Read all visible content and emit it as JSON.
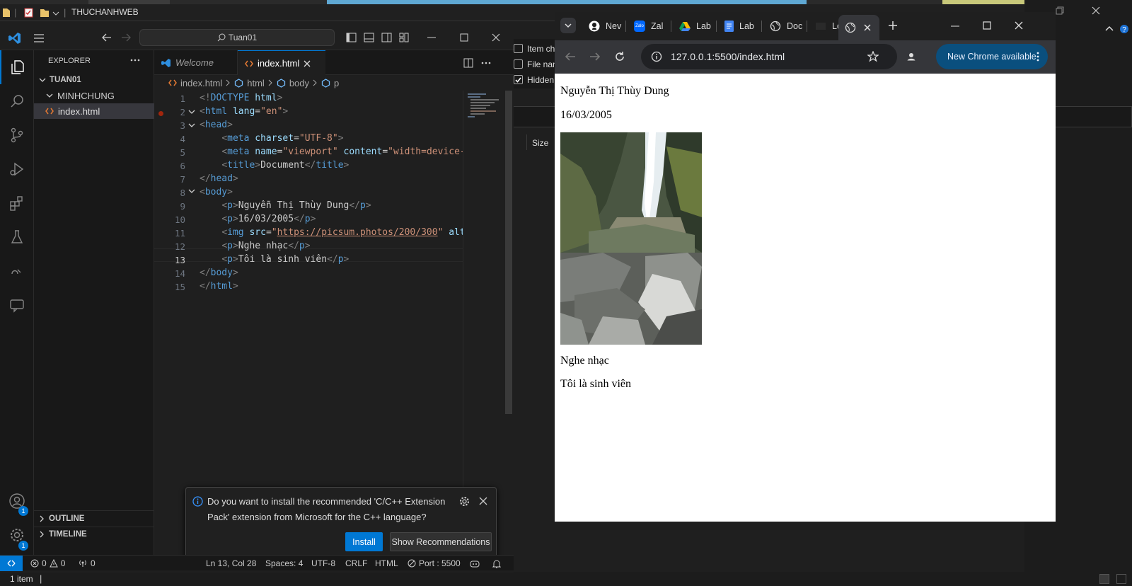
{
  "explorer": {
    "title": "THUCHANHWEB",
    "options": [
      "Item ch",
      "File nan",
      "Hidden"
    ],
    "column_size": "Size",
    "status": "1 item"
  },
  "vscode": {
    "search": "Tuan01",
    "sidebar": {
      "title": "EXPLORER",
      "root": "TUAN01",
      "folder": "MINHCHUNG",
      "file": "index.html",
      "outline": "OUTLINE",
      "timeline": "TIMELINE",
      "badges": [
        "1",
        "1"
      ]
    },
    "tabs": [
      {
        "label": "Welcome",
        "active": false
      },
      {
        "label": "index.html",
        "active": true
      }
    ],
    "breadcrumb": [
      "index.html",
      "html",
      "body",
      "p"
    ],
    "line_numbers": [
      "1",
      "2",
      "3",
      "4",
      "5",
      "6",
      "7",
      "8",
      "9",
      "10",
      "11",
      "12",
      "13",
      "14",
      "15"
    ],
    "code": {
      "l1_doctype": "DOCTYPE",
      "l1_html": "html",
      "l2_tag": "html",
      "l2_attr": "lang",
      "l2_val": "\"en\"",
      "l3_tag": "head",
      "l4_tag": "meta",
      "l4_attr": "charset",
      "l4_val": "\"UTF-8\"",
      "l5_tag": "meta",
      "l5_attr1": "name",
      "l5_val1": "\"viewport\"",
      "l5_attr2": "content",
      "l5_val2": "\"width=device-",
      "l6_tag": "title",
      "l6_text": "Document",
      "l7_tag": "head",
      "l8_tag": "body",
      "l9_tag": "p",
      "l9_text": "Nguyễn Thị Thùy Dung",
      "l10_tag": "p",
      "l10_text": "16/03/2005",
      "l11_tag": "img",
      "l11_attr": "src",
      "l11_url": "https://picsum.photos/200/300",
      "l11_attr2": "alt",
      "l12_tag": "p",
      "l12_text": "Nghe nhạc",
      "l13_tag": "p",
      "l13_text": "Tôi là sinh viên",
      "l14_tag": "body",
      "l15_tag": "html"
    },
    "notification": {
      "message": "Do you want to install the recommended 'C/C++ Extension Pack' extension from Microsoft for the C++ language?",
      "install": "Install",
      "show": "Show Recommendations"
    },
    "status": {
      "errors": "0",
      "warnings": "0",
      "ports": "0",
      "position": "Ln 13, Col 28",
      "spaces": "Spaces: 4",
      "encoding": "UTF-8",
      "eol": "CRLF",
      "language": "HTML",
      "port": "Port : 5500"
    }
  },
  "chrome": {
    "tabs": [
      "Nev",
      "Zal",
      "Lab",
      "Lab",
      "Doc",
      "Lor"
    ],
    "zalo_badge": "Zalo",
    "url": "127.0.0.1:5500/index.html",
    "update_button": "New Chrome available",
    "page": {
      "name": "Nguyễn Thị Thùy Dung",
      "dob": "16/03/2005",
      "hobby": "Nghe nhạc",
      "bio": "Tôi là sinh viên"
    }
  }
}
